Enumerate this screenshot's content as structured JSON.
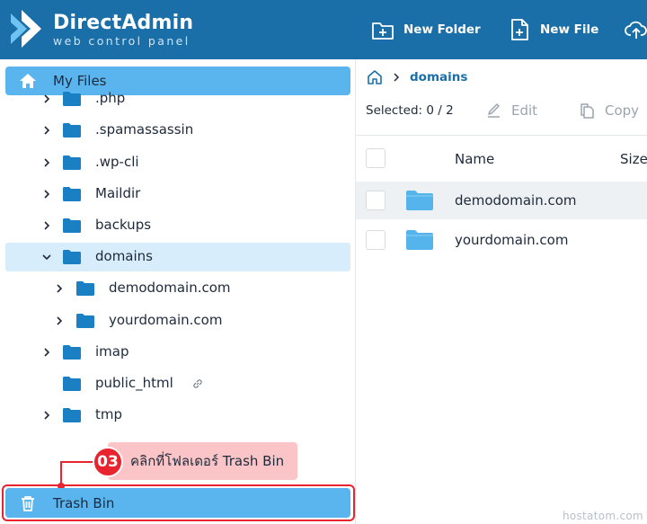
{
  "header": {
    "brand": "DirectAdmin",
    "tagline": "web control panel",
    "new_folder_label": "New Folder",
    "new_file_label": "New File"
  },
  "sidebar": {
    "root_label": "My Files",
    "items": [
      {
        "label": ".php"
      },
      {
        "label": ".spamassassin"
      },
      {
        "label": ".wp-cli"
      },
      {
        "label": "Maildir"
      },
      {
        "label": "backups"
      },
      {
        "label": "domains"
      },
      {
        "label": "demodomain.com"
      },
      {
        "label": "yourdomain.com"
      },
      {
        "label": "imap"
      },
      {
        "label": "public_html"
      },
      {
        "label": "tmp"
      }
    ],
    "trash_label": "Trash Bin"
  },
  "annotation": {
    "step": "03",
    "text": "คลิกที่โฟลเดอร์ Trash Bin"
  },
  "main": {
    "breadcrumb": "domains",
    "selected_text": "Selected: 0 / 2",
    "edit_label": "Edit",
    "copy_label": "Copy",
    "columns": [
      "Name",
      "Size"
    ],
    "files": [
      {
        "name": "demodomain.com"
      },
      {
        "name": "yourdomain.com"
      }
    ]
  },
  "watermark": "hostatom.com",
  "colors": {
    "header_bg": "#1b6fa8",
    "accent_blue": "#5ab4ee",
    "folder_blue": "#1b7fc4",
    "annotation_red": "#e8242e",
    "annotation_pink": "#fbc5c8"
  }
}
